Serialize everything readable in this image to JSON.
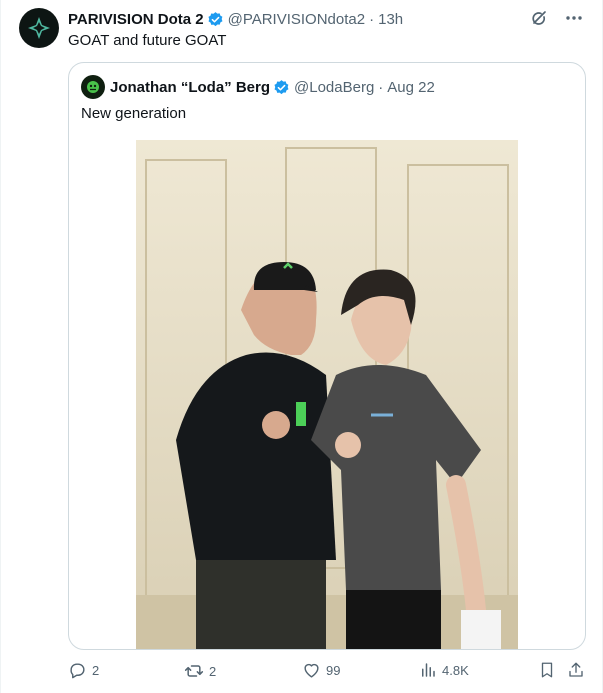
{
  "tweet": {
    "author_name": "PARIVISION Dota 2",
    "author_handle": "@PARIVISIONdota2",
    "separator": "·",
    "time": "13h",
    "text": "GOAT and future GOAT"
  },
  "quote": {
    "author_name": "Jonathan “Loda” Berg",
    "author_handle": "@LodaBerg",
    "separator": "·",
    "date": "Aug 22",
    "text": "New generation"
  },
  "actions": {
    "replies": "2",
    "reposts": "2",
    "likes": "99",
    "views": "4.8K"
  },
  "icons": {
    "verified": "verified-badge-icon",
    "grok": "grok-icon",
    "more": "more-icon",
    "reply": "reply-icon",
    "repost": "repost-icon",
    "like": "like-icon",
    "views": "views-icon",
    "bookmark": "bookmark-icon",
    "share": "share-icon"
  },
  "colors": {
    "verified": "#1d9bf0",
    "secondary_text": "#536471",
    "border": "#cfd9de",
    "primary_text": "#0f1419"
  }
}
